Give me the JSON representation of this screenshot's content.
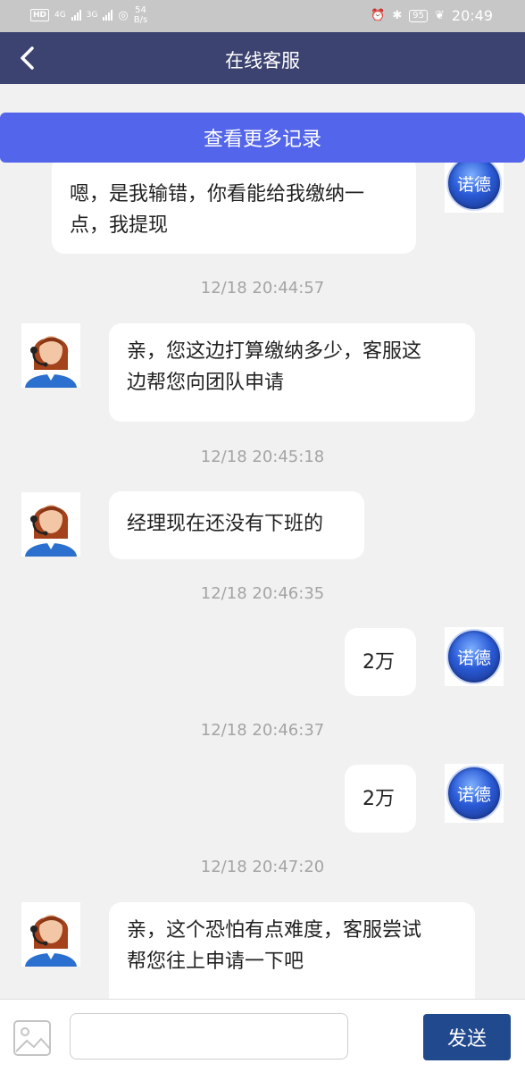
{
  "status_bar": {
    "net1": "4G",
    "net2": "3G",
    "speed": "54",
    "speed_unit": "B/s",
    "battery": "95",
    "time": "20:49"
  },
  "header": {
    "title": "在线客服"
  },
  "more_records": "查看更多记录",
  "user_avatar_text": "诺德",
  "messages": [
    {
      "sender": "user",
      "text_lines": [
        "嗯，是我输错，你看能给我缴纳一",
        "点，我提现"
      ]
    },
    {
      "time": "12/18 20:44:57",
      "sender": "agent",
      "text_lines": [
        "亲，您这边打算缴纳多少，客服这",
        "边帮您向团队申请"
      ]
    },
    {
      "time": "12/18 20:45:18",
      "sender": "agent",
      "text_lines": [
        "经理现在还没有下班的"
      ]
    },
    {
      "time": "12/18 20:46:35",
      "sender": "user",
      "text_lines": [
        "2万"
      ]
    },
    {
      "time": "12/18 20:46:37",
      "sender": "user",
      "text_lines": [
        "2万"
      ]
    },
    {
      "time": "12/18 20:47:20",
      "sender": "agent",
      "text_lines": [
        "亲，这个恐怕有点难度，客服尝试",
        "帮您往上申请一下吧"
      ]
    }
  ],
  "input": {
    "value": "",
    "placeholder": ""
  },
  "send_label": "发送",
  "colors": {
    "header_bg": "#3c4370",
    "more_bar_bg": "#5365ea",
    "send_bg": "#21498d",
    "chat_bg": "#f1f1f1"
  }
}
